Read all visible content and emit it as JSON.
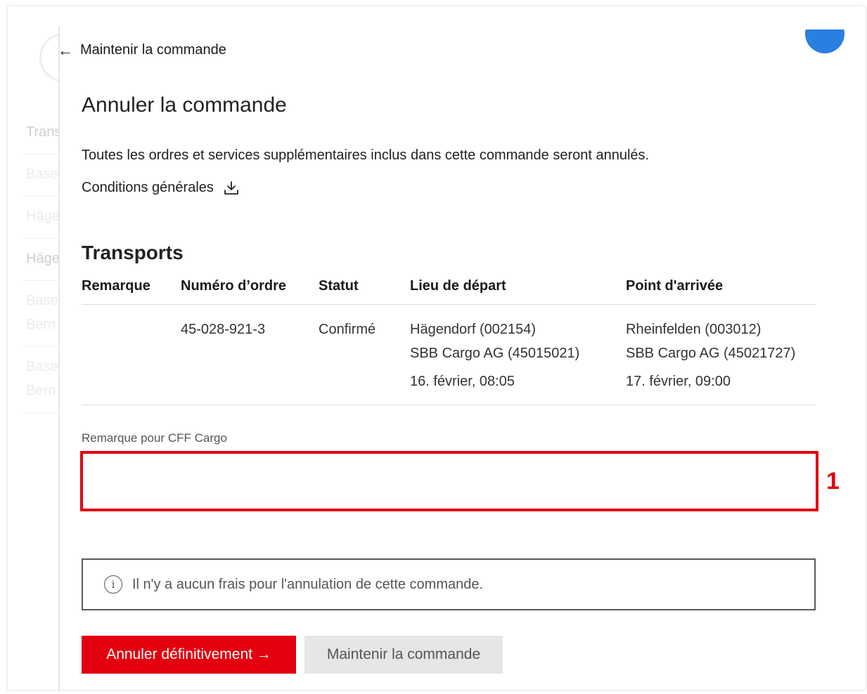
{
  "background_list": {
    "items": [
      "Trans",
      "Base",
      "Häge",
      "Häge",
      "Base",
      "Bern",
      "Base",
      "Bern"
    ]
  },
  "back_link": {
    "arrow": "←",
    "label": "Maintenir la commande"
  },
  "title": "Annuler la commande",
  "description": "Toutes les ordres et services supplémentaires inclus dans cette commande seront annulés.",
  "conditions": {
    "label": "Conditions générales",
    "icon": "download-icon"
  },
  "transports": {
    "title": "Transports",
    "columns": [
      "Remarque",
      "Numéro d’ordre",
      "Statut",
      "Lieu de départ",
      "Point d'arrivée"
    ],
    "rows": [
      {
        "remark": "",
        "order_number": "45-028-921-3",
        "status": "Confirmé",
        "departure": {
          "place": "Hägendorf (002154)",
          "company": "SBB Cargo AG (45015021)",
          "time": "16. février, 08:05"
        },
        "arrival": {
          "place": "Rheinfelden (003012)",
          "company": "SBB Cargo AG (45021727)",
          "time": "17. février, 09:00"
        }
      }
    ]
  },
  "remark_field": {
    "label": "Remarque pour CFF Cargo",
    "value": "",
    "marker": "1"
  },
  "info": {
    "icon": "info-icon",
    "text": "Il n'y a aucun frais pour l'annulation de cette commande."
  },
  "buttons": {
    "confirm": "Annuler définitivement →",
    "keep": "Maintenir la commande"
  },
  "colors": {
    "accent": "#e3000f",
    "status_ok": "#1f8a2e",
    "avatar": "#2a7fe0"
  }
}
